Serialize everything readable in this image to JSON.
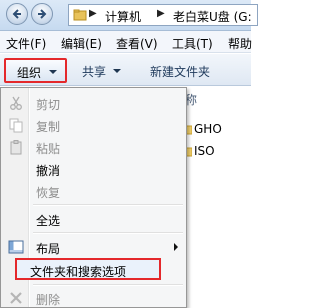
{
  "address_bar": {
    "breadcrumbs": [
      "计算机",
      "老白菜U盘 (G:"
    ]
  },
  "menubar": {
    "items": [
      "文件(F)",
      "编辑(E)",
      "查看(V)",
      "工具(T)",
      "帮助"
    ]
  },
  "command_bar": {
    "organize_label": "组织",
    "share_label": "共享",
    "new_folder_label": "新建文件夹"
  },
  "content": {
    "column_header": "称",
    "files": [
      {
        "name": "GHO"
      },
      {
        "name": "ISO"
      }
    ]
  },
  "organize_menu": {
    "items": [
      {
        "label": "剪切",
        "enabled": false
      },
      {
        "label": "复制",
        "enabled": false
      },
      {
        "label": "粘贴",
        "enabled": false
      },
      {
        "label": "撤消",
        "enabled": true
      },
      {
        "label": "恢复",
        "enabled": false
      },
      {
        "label": "全选",
        "enabled": true
      },
      {
        "label": "布局",
        "enabled": true,
        "has_submenu": true
      },
      {
        "label": "文件夹和搜索选项",
        "enabled": true,
        "highlighted": true
      },
      {
        "label": "删除",
        "enabled": false
      }
    ]
  },
  "colors": {
    "highlight_border": "#e4282b",
    "disabled_text": "#8d8d8d"
  }
}
